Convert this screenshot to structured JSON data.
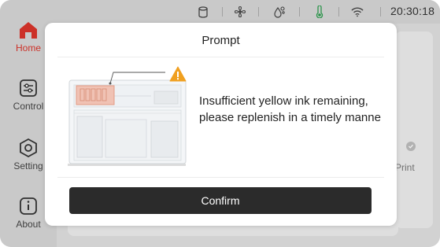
{
  "status_bar": {
    "time": "20:30:18",
    "icons": [
      "ink-cartridge-icon",
      "fan-icon",
      "filament-icon",
      "thermometer-icon",
      "alert-icon",
      "wifi-icon"
    ]
  },
  "sidebar": {
    "items": [
      {
        "label": "Home",
        "icon": "home-icon",
        "active": true
      },
      {
        "label": "Control",
        "icon": "sliders-icon",
        "active": false
      },
      {
        "label": "Setting",
        "icon": "settings-hexagon-icon",
        "active": false
      },
      {
        "label": "About",
        "icon": "info-icon",
        "active": false
      }
    ]
  },
  "background": {
    "print_label": "Print"
  },
  "modal": {
    "title": "Prompt",
    "message": "Insufficient yellow ink remaining, please replenish in a timely manne",
    "confirm_label": "Confirm",
    "warning_icon": "warning-triangle-icon"
  },
  "colors": {
    "accent_red": "#d9352b",
    "warning_orange": "#f0a020",
    "thermometer_green": "#2e9e4f",
    "button_dark": "#2b2b2b"
  }
}
